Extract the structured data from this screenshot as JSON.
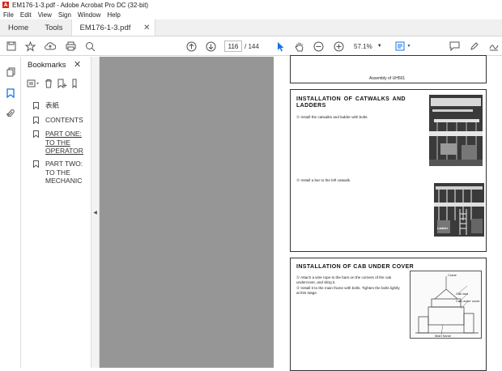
{
  "window": {
    "title": "EM176-1-3.pdf - Adobe Acrobat Pro DC (32-bit)"
  },
  "menu": [
    "File",
    "Edit",
    "View",
    "Sign",
    "Window",
    "Help"
  ],
  "tabs": {
    "home": "Home",
    "tools": "Tools",
    "document": "EM176-1-3.pdf"
  },
  "toolbar": {
    "page_current": "116",
    "page_total": "/ 144",
    "zoom": "57.1%"
  },
  "bookmarks": {
    "title": "Bookmarks",
    "items": [
      {
        "label": "表紙"
      },
      {
        "label": "CONTENTS"
      },
      {
        "label": "PART ONE: TO THE OPERATOR"
      },
      {
        "label": "PART TWO: TO THE MECHANIC"
      }
    ]
  },
  "document": {
    "top_caption": "Assembly of UH501",
    "section1": {
      "heading": "INSTALLATION OF CATWALKS AND LADDERS",
      "step1": "① Install the catwalks and ladder with bolts.",
      "step2": "② Install a bar to the left catwalk.",
      "photo_label": "Ladder"
    },
    "section2": {
      "heading": "INSTALLATION OF CAB UNDER COVER",
      "step1": "① Attach a wire rope to the bars on the corners of the cab undercover, and sling it.",
      "step2": "② Install it to the main frame with bolts. Tighten the bolts lightly at this stage.",
      "labels": {
        "crane": "Crane",
        "cab_bed": "Cab bed",
        "cab_under_cover": "Cab under cover",
        "main_frame": "Main frame"
      }
    }
  },
  "colors": {
    "acrobat_red": "#d7261c",
    "toolbar_blue": "#1473e6",
    "viewer_bg": "#c8c8c8"
  }
}
